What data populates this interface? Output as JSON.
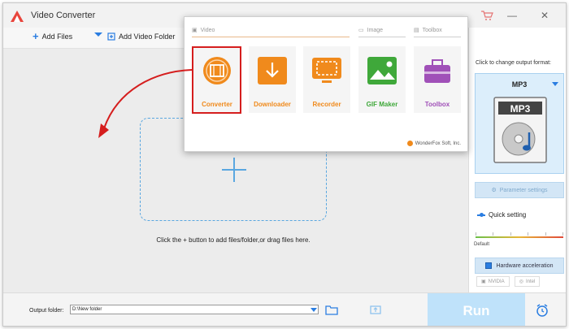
{
  "app": {
    "title": "Video Converter"
  },
  "toolbar": {
    "add_files": "Add Files",
    "add_video_folder": "Add Video Folder"
  },
  "main": {
    "hint": "Click the + button to add files/folder,or drag files here."
  },
  "side": {
    "change_label": "Click to change output format:",
    "format": "MP3",
    "format_icon_text": "MP3",
    "parameter_settings": "Parameter settings",
    "quick_setting": "Quick setting",
    "default_label": "Default",
    "hardware_acceleration": "Hardware acceleration",
    "gpu_nvidia": "NVIDIA",
    "gpu_intel": "Intel"
  },
  "bottom": {
    "output_label": "Output folder:",
    "output_value": "D:\\New folder",
    "run": "Run"
  },
  "popup": {
    "categories": {
      "video": "Video",
      "image": "Image",
      "toolbox": "Toolbox"
    },
    "tiles": [
      {
        "label": "Converter",
        "color": "#f08a1c"
      },
      {
        "label": "Downloader",
        "color": "#f08a1c"
      },
      {
        "label": "Recorder",
        "color": "#f08a1c"
      },
      {
        "label": "GIF Maker",
        "color": "#3fa83a"
      },
      {
        "label": "Toolbox",
        "color": "#a050b8"
      }
    ],
    "brand": "WonderFox Soft, Inc."
  },
  "colors": {
    "accent": "#2a7de1",
    "highlight": "#d51e1e",
    "orange": "#f08a1c"
  }
}
